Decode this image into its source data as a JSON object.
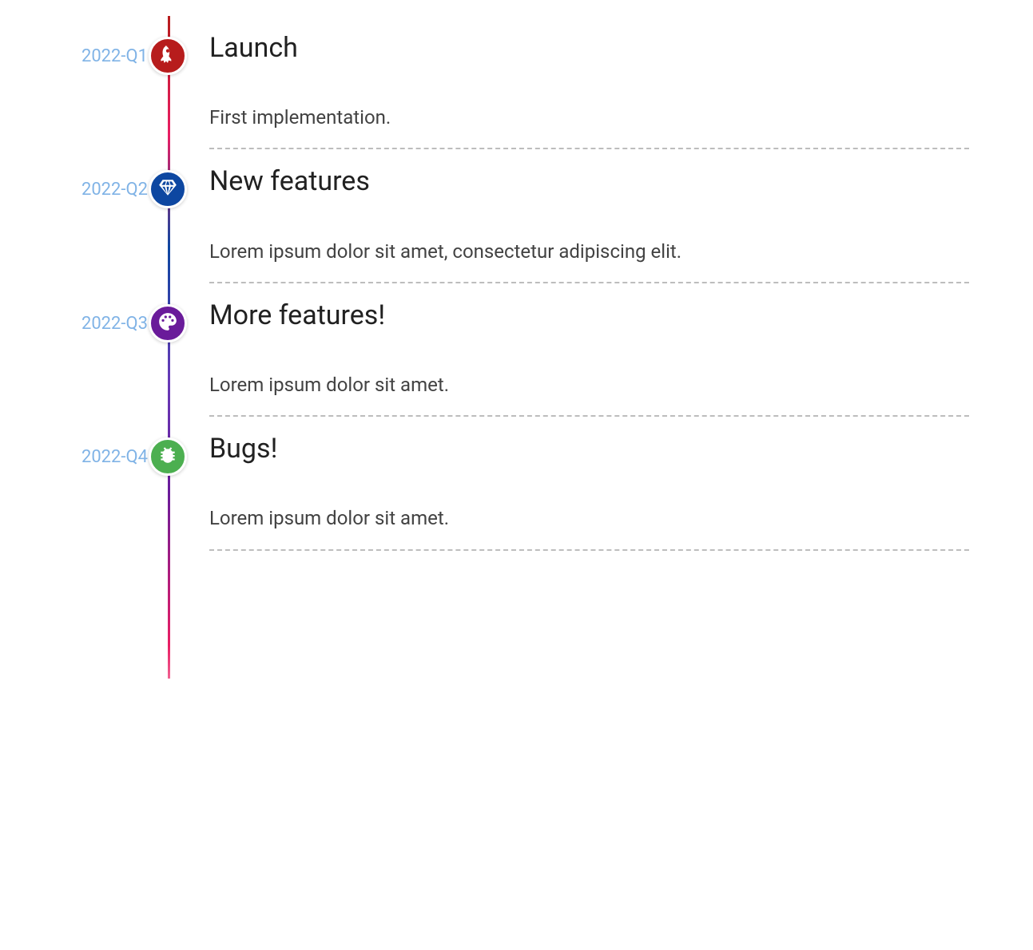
{
  "timeline": {
    "items": [
      {
        "date": "2022-Q1",
        "title": "Launch",
        "description": "First implementation.",
        "icon": "rocket",
        "color": "#b71c1c"
      },
      {
        "date": "2022-Q2",
        "title": "New features",
        "description": "Lorem ipsum dolor sit amet, consectetur adipiscing elit.",
        "icon": "gem",
        "color": "#0d47a1"
      },
      {
        "date": "2022-Q3",
        "title": "More features!",
        "description": "Lorem ipsum dolor sit amet.",
        "icon": "palette",
        "color": "#6a1b9a"
      },
      {
        "date": "2022-Q4",
        "title": "Bugs!",
        "description": "Lorem ipsum dolor sit amet.",
        "icon": "bug",
        "color": "#4caf50"
      }
    ]
  }
}
